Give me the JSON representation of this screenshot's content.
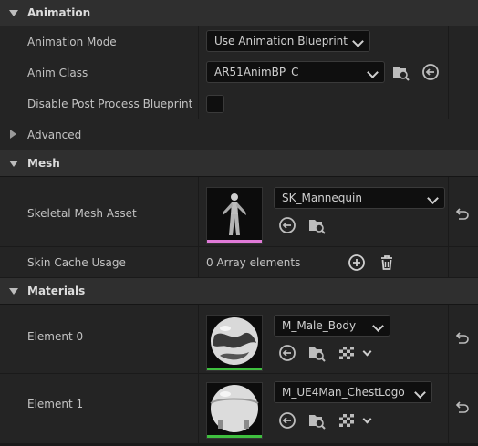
{
  "sections": {
    "animation": "Animation",
    "mesh": "Mesh",
    "materials": "Materials"
  },
  "animation": {
    "mode_label": "Animation Mode",
    "mode_value": "Use Animation Blueprint",
    "class_label": "Anim Class",
    "class_value": "AR51AnimBP_C",
    "disable_pp_label": "Disable Post Process Blueprint",
    "disable_pp_checked": false,
    "advanced_label": "Advanced"
  },
  "mesh": {
    "skeletal_label": "Skeletal Mesh Asset",
    "skeletal_value": "SK_Mannequin",
    "skin_cache_label": "Skin Cache Usage",
    "skin_cache_value": "0 Array elements"
  },
  "materials": {
    "element0_label": "Element 0",
    "element0_value": "M_Male_Body",
    "element1_label": "Element 1",
    "element1_value": "M_UE4Man_ChestLogo"
  },
  "colors": {
    "mesh_thumb_bar": "#e07ad8",
    "material_thumb_bar": "#3fbf3f"
  },
  "icons": [
    "chevron-down-icon",
    "browse-icon",
    "use-selected-icon",
    "reset-arrow-icon",
    "add-icon",
    "trash-icon",
    "checker-icon"
  ]
}
